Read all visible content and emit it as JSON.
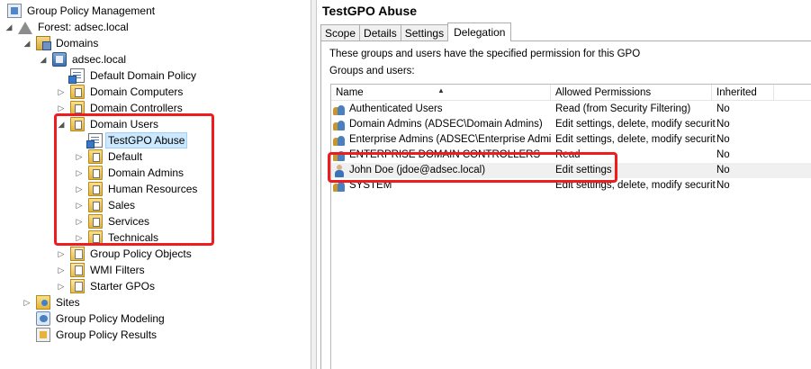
{
  "tree": {
    "root": "Group Policy Management",
    "forest": "Forest: adsec.local",
    "domains": "Domains",
    "domain": "adsec.local",
    "default_domain_policy": "Default Domain Policy",
    "domain_computers": "Domain Computers",
    "domain_controllers": "Domain Controllers",
    "domain_users": "Domain Users",
    "testgpo": "TestGPO Abuse",
    "default": "Default",
    "domain_admins": "Domain Admins",
    "human_resources": "Human Resources",
    "sales": "Sales",
    "services": "Services",
    "technicals": "Technicals",
    "gpo_objects": "Group Policy Objects",
    "wmi_filters": "WMI Filters",
    "starter_gpos": "Starter GPOs",
    "sites": "Sites",
    "modeling": "Group Policy Modeling",
    "results": "Group Policy Results"
  },
  "details": {
    "title": "TestGPO Abuse",
    "tabs": [
      "Scope",
      "Details",
      "Settings",
      "Delegation"
    ],
    "active_tab": "Delegation",
    "description": "These groups and users have the specified permission for this GPO",
    "groups_label": "Groups and users:",
    "columns": [
      "Name",
      "Allowed Permissions",
      "Inherited"
    ],
    "rows": [
      {
        "name": "Authenticated Users",
        "perm": "Read (from Security Filtering)",
        "inh": "No",
        "icon": "group-icon"
      },
      {
        "name": "Domain Admins (ADSEC\\Domain Admins)",
        "perm": "Edit settings, delete, modify security",
        "inh": "No",
        "icon": "group-icon"
      },
      {
        "name": "Enterprise Admins (ADSEC\\Enterprise Admins)",
        "perm": "Edit settings, delete, modify security",
        "inh": "No",
        "icon": "group-icon"
      },
      {
        "name": "ENTERPRISE DOMAIN CONTROLLERS",
        "perm": "Read",
        "inh": "No",
        "icon": "group-icon"
      },
      {
        "name": "John Doe (jdoe@adsec.local)",
        "perm": "Edit settings",
        "inh": "No",
        "icon": "user-icon"
      },
      {
        "name": "SYSTEM",
        "perm": "Edit settings, delete, modify security",
        "inh": "No",
        "icon": "group-icon"
      }
    ]
  },
  "colors": {
    "annotation": "#ee1c1c",
    "selection": "#cce8ff",
    "row_hover": "#f0f0f0"
  }
}
